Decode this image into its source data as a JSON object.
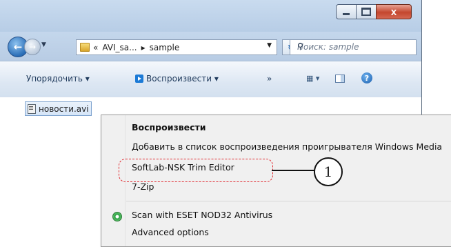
{
  "window": {
    "buttons": {
      "minimize_icon": "minimize-icon",
      "maximize_icon": "maximize-icon",
      "close_label": "x"
    },
    "nav": {
      "back_icon": "back-arrow-icon",
      "forward_icon": "forward-arrow-icon"
    },
    "address": {
      "prefix": "«",
      "path_parts": [
        "AVI_sa...",
        "▸",
        "sample"
      ]
    },
    "search": {
      "placeholder": "Поиск: sample"
    },
    "toolbar": {
      "organize": "Упорядочить ▾",
      "play": "Воспроизвести ▾",
      "more": "»"
    },
    "file": {
      "name": "новости.avi"
    }
  },
  "context_menu": {
    "items": [
      {
        "label": "Воспроизвести",
        "bold": true
      },
      {
        "label": "Добавить в список воспроизведения проигрывателя Windows Media"
      },
      {
        "label": "SoftLab-NSK Trim Editor"
      },
      {
        "label": "7-Zip"
      },
      {
        "label": "Scan with ESET NOD32 Antivirus",
        "icon": "eset-icon"
      },
      {
        "label": "Advanced options"
      }
    ]
  },
  "annotation": {
    "callout_number": "1",
    "highlight_color": "#e0252b"
  },
  "colors": {
    "accent": "#2a6db6",
    "close_button": "#c4462e"
  }
}
